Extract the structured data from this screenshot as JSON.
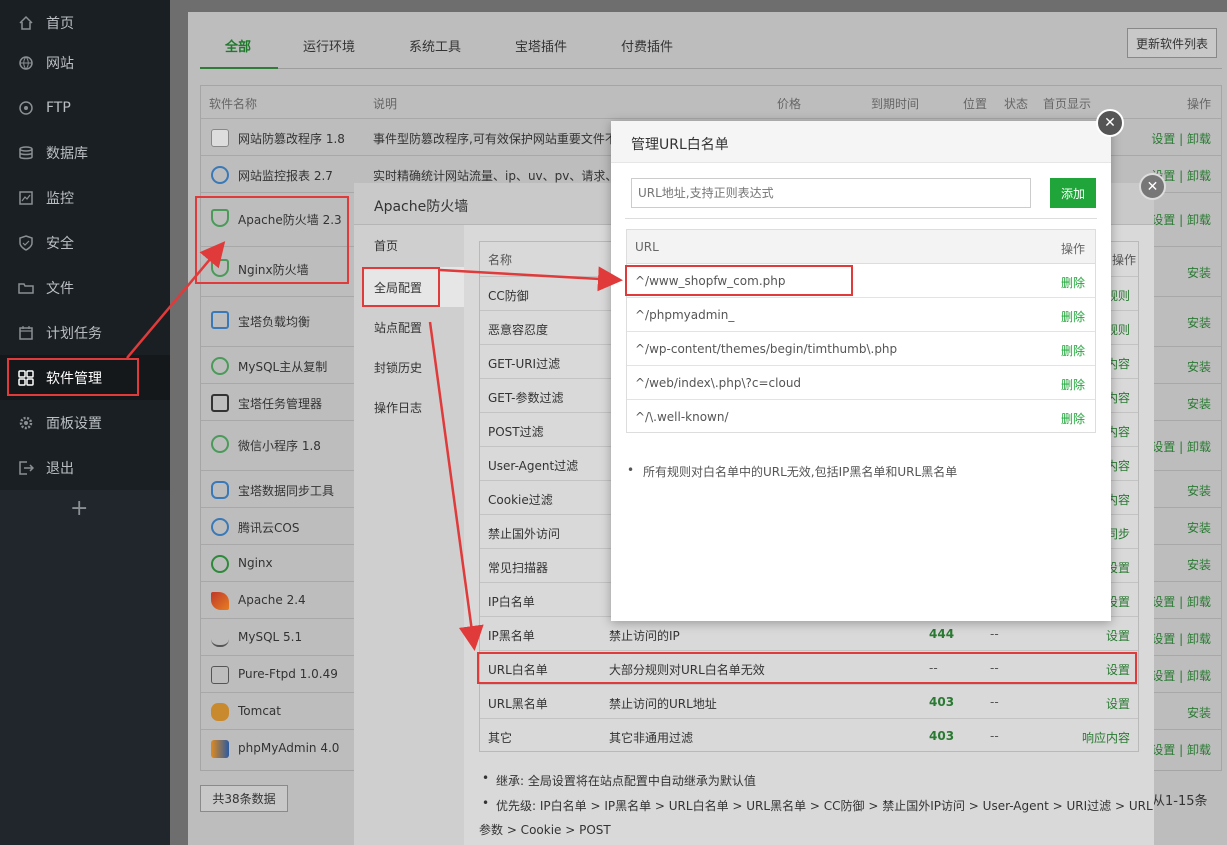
{
  "sidebar": {
    "items": [
      {
        "label": "首页",
        "icon": "home-icon"
      },
      {
        "label": "网站",
        "icon": "globe-icon"
      },
      {
        "label": "FTP",
        "icon": "ftp-icon"
      },
      {
        "label": "数据库",
        "icon": "database-icon"
      },
      {
        "label": "监控",
        "icon": "monitor-icon"
      },
      {
        "label": "安全",
        "icon": "shield-icon"
      },
      {
        "label": "文件",
        "icon": "folder-icon"
      },
      {
        "label": "计划任务",
        "icon": "calendar-icon"
      },
      {
        "label": "软件管理",
        "icon": "grid-icon"
      },
      {
        "label": "面板设置",
        "icon": "gear-icon"
      },
      {
        "label": "退出",
        "icon": "logout-icon"
      }
    ],
    "add": "+"
  },
  "tabs": [
    "全部",
    "运行环境",
    "系统工具",
    "宝塔插件",
    "付费插件"
  ],
  "update_button": "更新软件列表",
  "soft_table": {
    "headers": {
      "name": "软件名称",
      "desc": "说明",
      "price": "价格",
      "expire": "到期时间",
      "pos": "位置",
      "status": "状态",
      "home": "首页显示",
      "ops": "操作"
    },
    "rows": [
      {
        "name": "网站防篡改程序 1.8",
        "desc": "事件型防篡改程序,可有效保护网站重要文件不",
        "op": "设置 | 卸载"
      },
      {
        "name": "网站监控报表 2.7",
        "desc": "实时精确统计网站流量、ip、uv、pv、请求、",
        "op": "设置 | 卸载"
      },
      {
        "name": "Apache防火墙 2.3",
        "desc": "",
        "op": "设置 | 卸载"
      },
      {
        "name": "Nginx防火墙",
        "desc": "",
        "op": "安装"
      },
      {
        "name": "宝塔负载均衡",
        "desc": "",
        "op": "安装"
      },
      {
        "name": "MySQL主从复制",
        "desc": "",
        "op": "安装"
      },
      {
        "name": "宝塔任务管理器",
        "desc": "",
        "op": "安装"
      },
      {
        "name": "微信小程序 1.8",
        "desc": "",
        "op": "设置 | 卸载"
      },
      {
        "name": "宝塔数据同步工具",
        "desc": "",
        "op": "安装"
      },
      {
        "name": "腾讯云COS",
        "desc": "",
        "op": "安装"
      },
      {
        "name": "Nginx",
        "desc": "",
        "op": "安装"
      },
      {
        "name": "Apache 2.4",
        "desc": "",
        "op": "设置 | 卸载"
      },
      {
        "name": "MySQL 5.1",
        "desc": "",
        "op": "设置 | 卸载"
      },
      {
        "name": "Pure-Ftpd 1.0.49",
        "desc": "",
        "op": "设置 | 卸载"
      },
      {
        "name": "Tomcat",
        "desc": "",
        "op": "安装"
      },
      {
        "name": "phpMyAdmin 4.0",
        "desc": "",
        "op": "设置 | 卸载"
      }
    ],
    "total": "共38条数据",
    "pager": "从1-15条"
  },
  "firewall": {
    "title": "Apache防火墙",
    "menu": [
      "首页",
      "全局配置",
      "站点配置",
      "封锁历史",
      "操作日志"
    ],
    "header_name": "名称",
    "header_ops": "操作",
    "rules": [
      {
        "name": "CC防御",
        "desc": "",
        "value": "",
        "status": "",
        "op": "规则"
      },
      {
        "name": "恶意容忍度",
        "desc": "",
        "value": "",
        "status": "",
        "op": "规则"
      },
      {
        "name": "GET-URI过滤",
        "desc": "",
        "value": "",
        "status": "",
        "op": "内容"
      },
      {
        "name": "GET-参数过滤",
        "desc": "",
        "value": "",
        "status": "",
        "op": "内容"
      },
      {
        "name": "POST过滤",
        "desc": "",
        "value": "",
        "status": "",
        "op": "内容"
      },
      {
        "name": "User-Agent过滤",
        "desc": "",
        "value": "",
        "status": "",
        "op": "内容"
      },
      {
        "name": "Cookie过滤",
        "desc": "",
        "value": "",
        "status": "",
        "op": "内容"
      },
      {
        "name": "禁止国外访问",
        "desc": "",
        "value": "",
        "status": "",
        "op": "同步"
      },
      {
        "name": "常见扫描器",
        "desc": "",
        "value": "",
        "status": "",
        "op": "设置"
      },
      {
        "name": "IP白名单",
        "desc": "",
        "value": "",
        "status": "",
        "op": "设置"
      },
      {
        "name": "IP黑名单",
        "desc": "禁止访问的IP",
        "value": "444",
        "status": "--",
        "op": "设置"
      },
      {
        "name": "URL白名单",
        "desc": "大部分规则对URL白名单无效",
        "value": "--",
        "status": "--",
        "op": "设置"
      },
      {
        "name": "URL黑名单",
        "desc": "禁止访问的URL地址",
        "value": "403",
        "status": "--",
        "op": "设置"
      },
      {
        "name": "其它",
        "desc": "其它非通用过滤",
        "value": "403",
        "status": "--",
        "op": "响应内容"
      }
    ],
    "notes": [
      "继承: 全局设置将在站点配置中自动继承为默认值",
      "优先级: IP白名单 > IP黑名单 > URL白名单 > URL黑名单 > CC防御 > 禁止国外IP访问 > User-Agent > URI过滤 > URL",
      "参数 > Cookie > POST"
    ]
  },
  "whitelist": {
    "title": "管理URL白名单",
    "placeholder": "URL地址,支持正则表达式",
    "add": "添加",
    "col_url": "URL",
    "col_op": "操作",
    "rows": [
      {
        "url": "^/www_shopfw_com.php",
        "op": "删除"
      },
      {
        "url": "^/phpmyadmin_",
        "op": "删除"
      },
      {
        "url": "^/wp-content/themes/begin/timthumb\\.php",
        "op": "删除"
      },
      {
        "url": "^/web/index\\.php\\?c=cloud",
        "op": "删除"
      },
      {
        "url": "^/\\.well-known/",
        "op": "删除"
      }
    ],
    "note": "所有规则对白名单中的URL无效,包括IP黑名单和URL黑名单"
  },
  "colors": {
    "accent": "#20a53a",
    "highlight": "#e03a3a"
  }
}
